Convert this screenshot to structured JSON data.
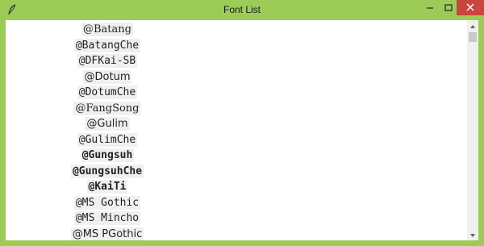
{
  "window": {
    "title": "Font List",
    "icons": {
      "app": "feather-icon",
      "minimize": "minimize-icon",
      "maximize": "maximize-icon",
      "close": "close-icon"
    },
    "colors": {
      "frame": "#9ccb57",
      "close_button": "#c7463e",
      "item_background": "#f0f0f0"
    }
  },
  "font_list": {
    "items": [
      "@Batang",
      "@BatangChe",
      "@DFKai-SB",
      "@Dotum",
      "@DotumChe",
      "@FangSong",
      "@Gulim",
      "@GulimChe",
      "@Gungsuh",
      "@GungsuhChe",
      "@KaiTi",
      "@MS Gothic",
      "@MS Mincho",
      "@MS PGothic"
    ]
  },
  "scrollbar": {
    "position": 0.0
  }
}
